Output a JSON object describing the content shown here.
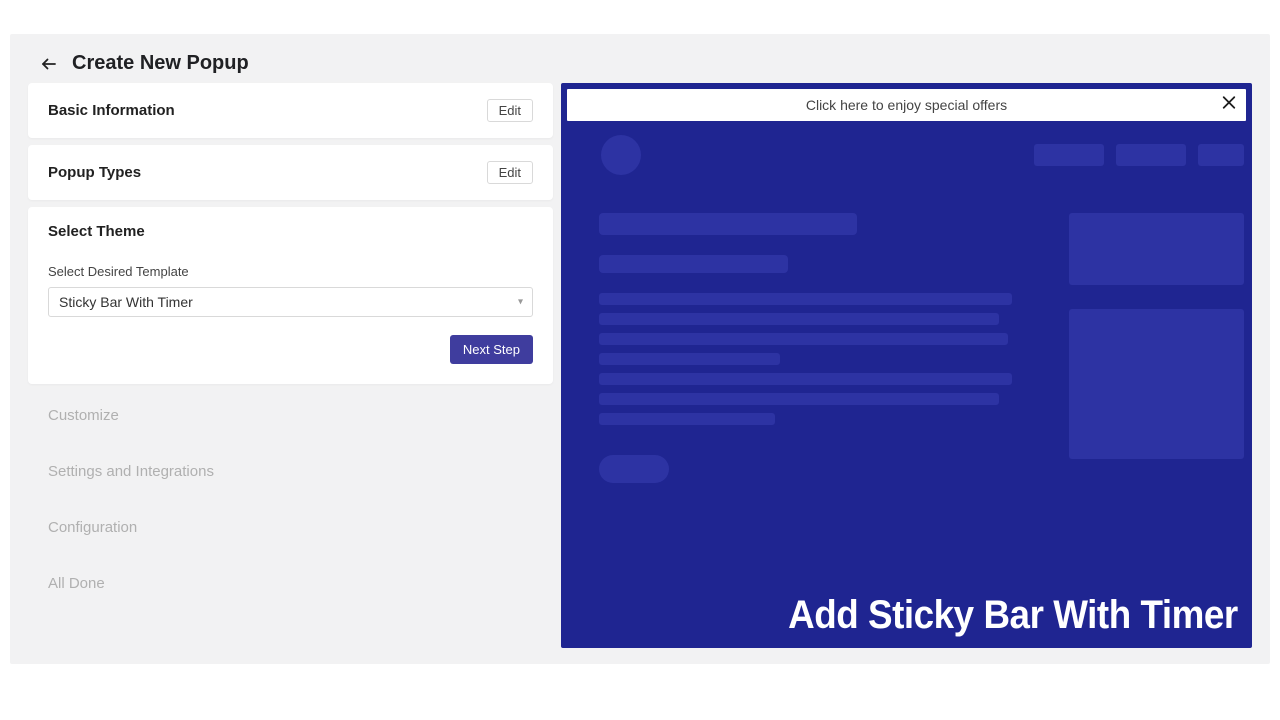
{
  "header": {
    "title": "Create New Popup"
  },
  "steps": {
    "basic_info": {
      "title": "Basic Information",
      "edit_label": "Edit"
    },
    "popup_types": {
      "title": "Popup Types",
      "edit_label": "Edit"
    },
    "select_theme": {
      "title": "Select Theme",
      "field_label": "Select Desired Template",
      "selected_value": "Sticky Bar With Timer",
      "next_label": "Next Step"
    },
    "customize": {
      "title": "Customize"
    },
    "settings": {
      "title": "Settings and Integrations"
    },
    "configuration": {
      "title": "Configuration"
    },
    "all_done": {
      "title": "All Done"
    }
  },
  "preview": {
    "sticky_bar_text": "Click here to enjoy special offers",
    "caption": "Add Sticky Bar With Timer"
  },
  "colors": {
    "accent": "#3f3d9e",
    "preview_bg": "#1f2591",
    "outer_bg": "#b39ecf"
  }
}
